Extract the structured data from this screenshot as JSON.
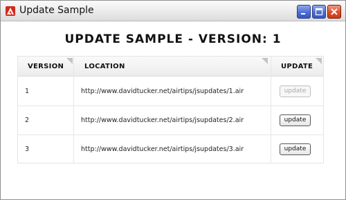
{
  "window": {
    "title": "Update Sample"
  },
  "heading": "UPDATE SAMPLE - VERSION: 1",
  "table": {
    "columns": [
      "VERSION",
      "LOCATION",
      "UPDATE"
    ],
    "rows": [
      {
        "version": "1",
        "location": "http://www.davidtucker.net/airtips/jsupdates/1.air",
        "button": "update",
        "enabled": false
      },
      {
        "version": "2",
        "location": "http://www.davidtucker.net/airtips/jsupdates/2.air",
        "button": "update",
        "enabled": true
      },
      {
        "version": "3",
        "location": "http://www.davidtucker.net/airtips/jsupdates/3.air",
        "button": "update",
        "enabled": true
      }
    ]
  },
  "icons": {
    "app": "adobe-air-icon",
    "minimize": "minimize-icon",
    "maximize": "maximize-icon",
    "close": "close-icon"
  },
  "colors": {
    "close_button": "#dd4d2a",
    "window_buttons": "#4e6fd5",
    "app_icon": "#d22a1e"
  }
}
